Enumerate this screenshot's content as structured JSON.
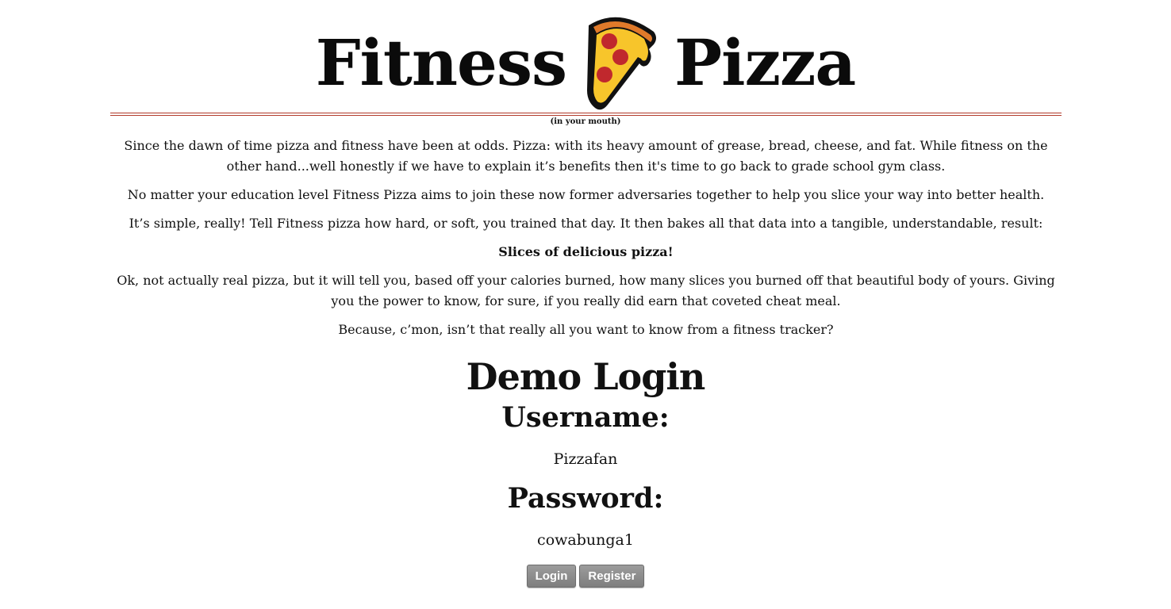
{
  "header": {
    "title_left": "Fitness",
    "logo_icon": "pizza-slice-icon",
    "title_right": "Pizza",
    "tagline": "(in your mouth)",
    "rule_color": "#b23a2a"
  },
  "intro": {
    "p1": "Since the dawn of time pizza and fitness have been at odds. Pizza: with its heavy amount of grease, bread, cheese, and fat. While fitness on the other hand...well honestly if we have to explain it’s benefits then it's time to go back to grade school gym class.",
    "p2": "No matter your education level Fitness Pizza aims to join these now former adversaries together to help you slice your way into better health.",
    "p3": "It’s simple, really! Tell Fitness pizza how hard, or soft, you trained that day. It then bakes all that data into a tangible, understandable, result:",
    "p4": "Slices of delicious pizza!",
    "p5": "Ok, not actually real pizza, but it will tell you, based off your calories burned, how many slices you burned off that beautiful body of yours. Giving you the power to know, for sure, if you really did earn that coveted cheat meal.",
    "p6": "Because, c’mon, isn’t that really all you want to know from a fitness tracker?"
  },
  "login": {
    "heading": "Demo Login",
    "username_label": "Username:",
    "username_value": "Pizzafan",
    "password_label": "Password:",
    "password_value": "cowabunga1",
    "login_button": "Login",
    "register_button": "Register",
    "button_color": "#8a8a8a"
  }
}
